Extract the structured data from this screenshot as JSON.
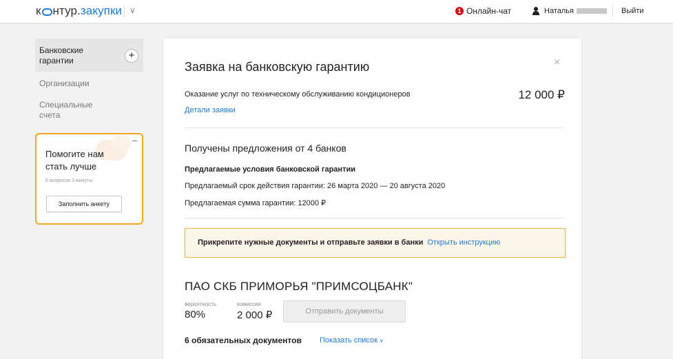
{
  "header": {
    "logo_prefix": "к",
    "logo_rest": "нтур.",
    "logo_accent": "закупки",
    "chevron": "∨",
    "chat_badge": "1",
    "chat_label": "Онлайн-чат",
    "user_name": "Наталья",
    "logout_label": "Выйти"
  },
  "sidebar": {
    "items": [
      {
        "label": "Банковские гарантии",
        "active": true
      },
      {
        "label": "Организации"
      },
      {
        "label": "Специальные счета"
      }
    ],
    "add_icon": "+",
    "promo": {
      "minimize": "–",
      "title": "Помогите нам стать лучше",
      "meta": "6 вопросов 3 минуты",
      "button": "Заполнить анкету"
    }
  },
  "main": {
    "close": "×",
    "title": "Заявка на банковскую гарантию",
    "service": "Оказание услуг по техническому обслуживанию кондиционеров",
    "price": "12 000 ₽",
    "details_link": "Детали заявки",
    "offers_title": "Получены предложения от 4 банков",
    "terms_title": "Предлагаемые условия банковской гарантии",
    "term_period": "Предлагаемый срок действия гарантии:  26 марта 2020 — 20 августа 2020",
    "term_amount": "Предлагаемая сумма гарантии: 12000 ₽",
    "notice_text": "Прикрепите нужные документы и отправьте заявки в банки",
    "notice_link": "Открыть инструкцию",
    "bank": {
      "name": "ПАО СКБ ПРИМОРЬЯ \"ПРИМСОЦБАНК\"",
      "probability_label": "вероятность",
      "probability_value": "80%",
      "commission_label": "комиссия",
      "commission_value": "2 000 ₽",
      "send_button": "Отправить документы",
      "docs_count": "6 обязательных документов",
      "show_list": "Показать список",
      "show_list_chevron": "∨"
    }
  },
  "colors": {
    "accent": "#1e7bd0",
    "badge": "#d70c17",
    "promo_border": "#f5a623",
    "notice_border": "#f2b04a",
    "notice_bg": "#fdf7e9"
  }
}
